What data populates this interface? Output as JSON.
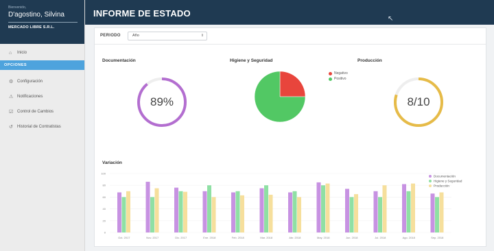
{
  "sidebar": {
    "welcome": "Bienvenido,",
    "user_name": "D'agostino, Silvina",
    "company": "MERCADO LIBRE S.R.L.",
    "home_label": "Inicio",
    "section_label": "OPCIONES",
    "items": [
      {
        "label": "Configuración",
        "icon": "gear-icon"
      },
      {
        "label": "Notificaciones",
        "icon": "warning-icon"
      },
      {
        "label": "Control de Cambios",
        "icon": "checkbox-icon"
      },
      {
        "label": "Historial de Contratistas",
        "icon": "history-icon"
      }
    ]
  },
  "header": {
    "title": "INFORME DE ESTADO"
  },
  "filter": {
    "label": "PERIODO",
    "selected": "Año"
  },
  "cards": {
    "documentacion": {
      "title": "Documentación",
      "value_text": "89%",
      "fraction": 0.89,
      "color": "#b36ed0"
    },
    "higiene": {
      "title": "Higiene y Seguridad",
      "slices": [
        {
          "name": "Negativo",
          "fraction": 0.25,
          "color": "#e8453c"
        },
        {
          "name": "Positivo",
          "fraction": 0.75,
          "color": "#52c864"
        }
      ]
    },
    "produccion": {
      "title": "Producción",
      "value_text": "8/10",
      "fraction": 0.8,
      "color": "#e6bb48"
    }
  },
  "variacion_title": "Variación",
  "chart_data": {
    "type": "bar",
    "ylim": [
      0,
      100
    ],
    "yticks": [
      "0",
      "20",
      "40",
      "60",
      "80",
      "100"
    ],
    "categories": [
      "Oct. 2017",
      "Nov. 2017",
      "Dic. 2017",
      "Ene. 2018",
      "Feb. 2018",
      "Mar. 2018",
      "Abr. 2018",
      "May. 2018",
      "Jun. 2018",
      "Jul. 2018",
      "Ago. 2018",
      "Sep. 2018"
    ],
    "series": [
      {
        "name": "Documentación",
        "color": "#c792e2",
        "values": [
          68,
          86,
          76,
          70,
          68,
          75,
          68,
          85,
          74,
          70,
          82,
          66
        ]
      },
      {
        "name": "Higiene y Seguridad",
        "color": "#8fe0a4",
        "values": [
          60,
          60,
          70,
          80,
          70,
          80,
          70,
          80,
          60,
          60,
          70,
          60
        ]
      },
      {
        "name": "Producción",
        "color": "#f6df9c",
        "values": [
          70,
          75,
          69,
          60,
          63,
          64,
          60,
          83,
          65,
          80,
          83,
          68
        ]
      }
    ],
    "legend_position": "top-right"
  }
}
